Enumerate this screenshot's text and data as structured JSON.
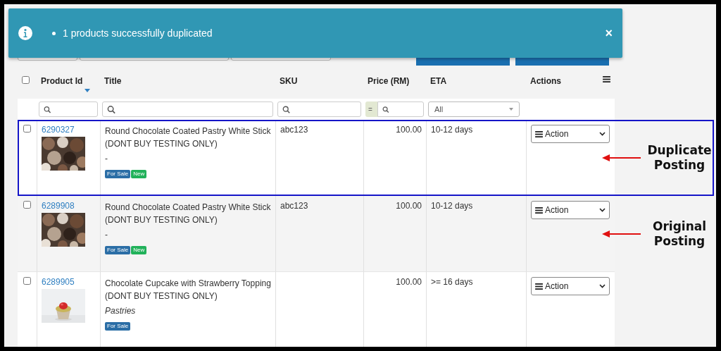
{
  "toast": {
    "message": "1 products successfully duplicated",
    "close": "×"
  },
  "table": {
    "select_all": {
      "checked": false
    },
    "columns": [
      {
        "label": "Product Id",
        "sorted": true
      },
      {
        "label": "Title",
        "sorted": false
      },
      {
        "label": "SKU",
        "sorted": false
      },
      {
        "label": "Price (RM)",
        "sorted": false
      },
      {
        "label": "ETA",
        "sorted": false
      },
      {
        "label": "Actions",
        "sorted": false
      }
    ],
    "filters": {
      "price_operator": "=",
      "eta": "All"
    },
    "rows": [
      {
        "checked": false,
        "highlighted": true,
        "id": "6290327",
        "title": "Round Chocolate Coated Pastry White Stick (DONT BUY TESTING ONLY)",
        "subtitle": "-",
        "subtitle_italic": false,
        "tags": [
          {
            "label": "For Sale",
            "color": "#2b6ea6"
          },
          {
            "label": "New",
            "color": "#21b15a"
          }
        ],
        "sku": "abc123",
        "price": "100.00",
        "eta": "10-12 days",
        "action": "Action",
        "annotation": "Duplicate Posting"
      },
      {
        "checked": false,
        "highlighted": false,
        "id": "6289908",
        "title": "Round Chocolate Coated Pastry White Stick (DONT BUY TESTING ONLY)",
        "subtitle": "-",
        "subtitle_italic": false,
        "tags": [
          {
            "label": "For Sale",
            "color": "#2b6ea6"
          },
          {
            "label": "New",
            "color": "#21b15a"
          }
        ],
        "sku": "abc123",
        "price": "100.00",
        "eta": "10-12 days",
        "action": "Action",
        "annotation": "Original Posting"
      },
      {
        "checked": false,
        "highlighted": false,
        "id": "6289905",
        "title": "Chocolate Cupcake with Strawberry Topping (DONT BUY TESTING ONLY)",
        "subtitle": "Pastries",
        "subtitle_italic": true,
        "tags": [
          {
            "label": "For Sale",
            "color": "#2b6ea6"
          }
        ],
        "price": "100.00",
        "eta": ">= 16 days",
        "action": "Action"
      }
    ]
  }
}
